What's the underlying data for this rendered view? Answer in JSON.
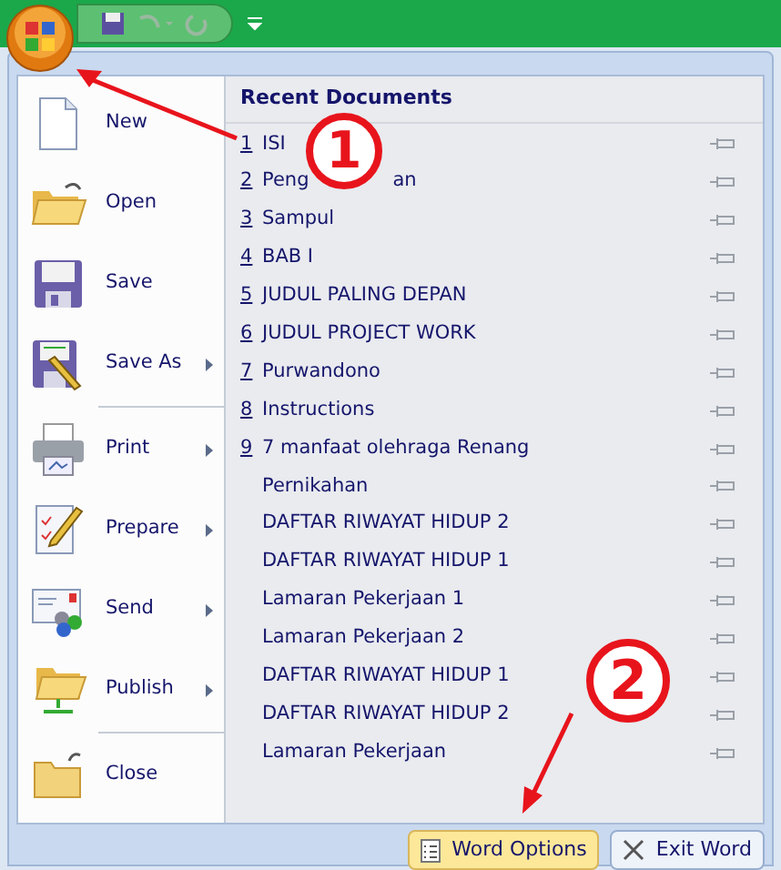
{
  "commands": [
    {
      "label": "New",
      "submenu": false
    },
    {
      "label": "Open",
      "submenu": false
    },
    {
      "label": "Save",
      "submenu": false
    },
    {
      "label": "Save As",
      "submenu": true,
      "divider_after": true
    },
    {
      "label": "Print",
      "submenu": true
    },
    {
      "label": "Prepare",
      "submenu": true
    },
    {
      "label": "Send",
      "submenu": true
    },
    {
      "label": "Publish",
      "submenu": true,
      "divider_after": true
    },
    {
      "label": "Close",
      "submenu": false
    }
  ],
  "recent": {
    "title": "Recent Documents",
    "items": [
      {
        "number": "1",
        "name": "ISI"
      },
      {
        "number": "2",
        "name": "Peng",
        "name_tail": "an"
      },
      {
        "number": "3",
        "name": "Sampul"
      },
      {
        "number": "4",
        "name": "BAB I"
      },
      {
        "number": "5",
        "name": "JUDUL PALING DEPAN"
      },
      {
        "number": "6",
        "name": "JUDUL PROJECT WORK"
      },
      {
        "number": "7",
        "name": "Purwandono"
      },
      {
        "number": "8",
        "name": "Instructions"
      },
      {
        "number": "9",
        "name": "7 manfaat olehraga Renang"
      },
      {
        "name": "Pernikahan"
      },
      {
        "name": "DAFTAR RIWAYAT HIDUP 2"
      },
      {
        "name": "DAFTAR RIWAYAT HIDUP 1"
      },
      {
        "name": "Lamaran Pekerjaan 1"
      },
      {
        "name": "Lamaran Pekerjaan 2"
      },
      {
        "name": "DAFTAR RIWAYAT HIDUP 1"
      },
      {
        "name": "DAFTAR RIWAYAT HIDUP 2"
      },
      {
        "name": "Lamaran Pekerjaan"
      }
    ]
  },
  "footer_buttons": [
    {
      "label": "Word Options",
      "selected": true
    },
    {
      "label": "Exit Word",
      "selected": false
    }
  ],
  "annotations": [
    "1",
    "2"
  ]
}
